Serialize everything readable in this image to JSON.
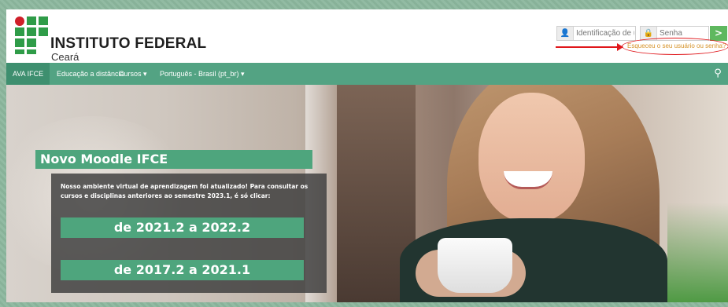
{
  "header": {
    "brand_title": "INSTITUTO FEDERAL",
    "brand_subtitle": "Ceará"
  },
  "login": {
    "username_placeholder": "Identificação de usuário",
    "password_placeholder": "Senha",
    "submit_glyph": ">",
    "forgot_link": "Esqueceu o seu usuário ou senha?"
  },
  "nav": {
    "items": [
      {
        "label": "AVA IFCE"
      },
      {
        "label": "Educação a distância"
      },
      {
        "label": "Cursos ▾"
      },
      {
        "label": "Português - Brasil (pt_br) ▾"
      }
    ]
  },
  "hero": {
    "title": "Novo Moodle IFCE",
    "text": "Nosso ambiente virtual de aprendizagem foi atualizado! Para consultar os cursos e disciplinas anteriores ao semestre 2023.1, é só clicar:",
    "buttons": [
      {
        "label": "de 2021.2 a 2022.2"
      },
      {
        "label": "de 2017.2 a 2021.1"
      }
    ]
  },
  "colors": {
    "brand_green": "#4ea57d",
    "nav_green": "#53a383",
    "logo_red": "#cf1f29",
    "annotation_red": "#e0171b",
    "link_orange": "#d6932a"
  }
}
